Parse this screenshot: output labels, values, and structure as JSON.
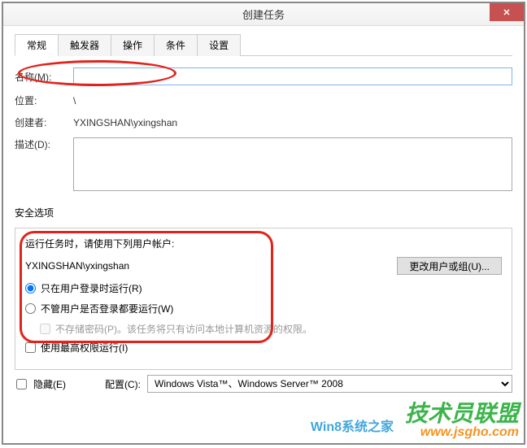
{
  "title": "创建任务",
  "tabs": [
    "常规",
    "触发器",
    "操作",
    "条件",
    "设置"
  ],
  "form": {
    "name_label": "名称(M):",
    "name_value": "",
    "location_label": "位置:",
    "location_value": "\\",
    "creator_label": "创建者:",
    "creator_value": "YXINGSHAN\\yxingshan",
    "desc_label": "描述(D):",
    "desc_value": ""
  },
  "security": {
    "section_label": "安全选项",
    "run_as_label": "运行任务时，请使用下列用户帐户:",
    "account": "YXINGSHAN\\yxingshan",
    "change_btn": "更改用户或组(U)...",
    "radio_logged_on": "只在用户登录时运行(R)",
    "radio_any": "不管用户是否登录都要运行(W)",
    "no_store_pwd": "不存储密码(P)。该任务将只有访问本地计算机资源的权限。",
    "highest_priv": "使用最高权限运行(I)"
  },
  "bottom": {
    "hidden_label": "隐藏(E)",
    "config_label": "配置(C):",
    "config_value": "Windows Vista™、Windows Server™ 2008"
  },
  "watermark": {
    "big": "技术员联盟",
    "url": "www.jsgho.com",
    "blue": "Win8系统之家"
  }
}
